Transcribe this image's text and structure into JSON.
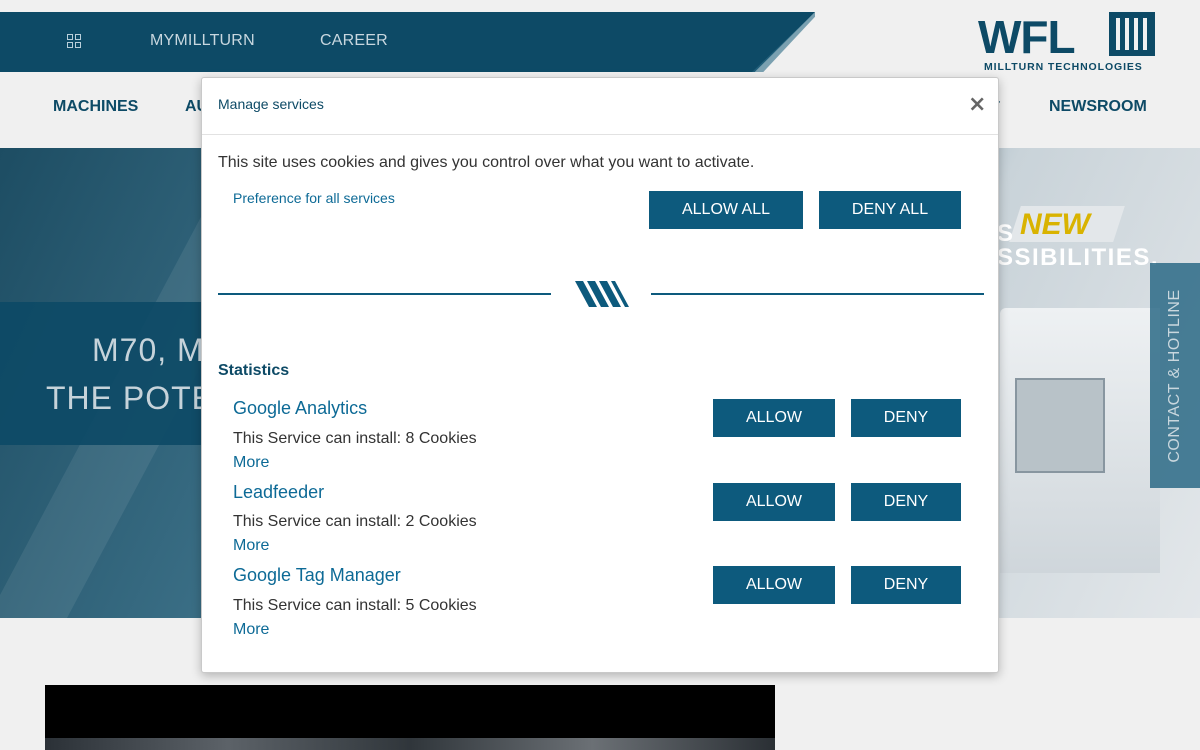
{
  "topbar": {
    "links": [
      "MYMILLTURN",
      "CAREER"
    ]
  },
  "logo": {
    "name": "WFL",
    "tagline": "MILLTURN TECHNOLOGIES"
  },
  "nav": {
    "items": [
      "MACHINES",
      "AU",
      "NEWSROOM"
    ]
  },
  "hero": {
    "line1": "M70, M",
    "line2": "THE POTE",
    "badge_new": "NEW",
    "headline_fragment": "SSIBILITIES.",
    "headline_start": "S",
    "contact_tab": "CONTACT & HOTLINE"
  },
  "modal": {
    "title": "Manage services",
    "close": "×",
    "intro": "This site uses cookies and gives you control over what you want to activate.",
    "preference_all": "Preference for all services",
    "allow_all": "ALLOW ALL",
    "deny_all": "DENY ALL",
    "section_title": "Statistics",
    "services": [
      {
        "name": "Google Analytics",
        "desc": "This Service can install: 8 Cookies",
        "more": "More",
        "allow": "ALLOW",
        "deny": "DENY"
      },
      {
        "name": "Leadfeeder",
        "desc": "This Service can install: 2 Cookies",
        "more": "More",
        "allow": "ALLOW",
        "deny": "DENY"
      },
      {
        "name": "Google Tag Manager",
        "desc": "This Service can install: 5 Cookies",
        "more": "More",
        "allow": "ALLOW",
        "deny": "DENY"
      }
    ]
  },
  "colors": {
    "brand_dark": "#0d4a66",
    "button": "#0d5a7d",
    "link": "#0d6a96",
    "accent_yellow": "#d9b300"
  }
}
